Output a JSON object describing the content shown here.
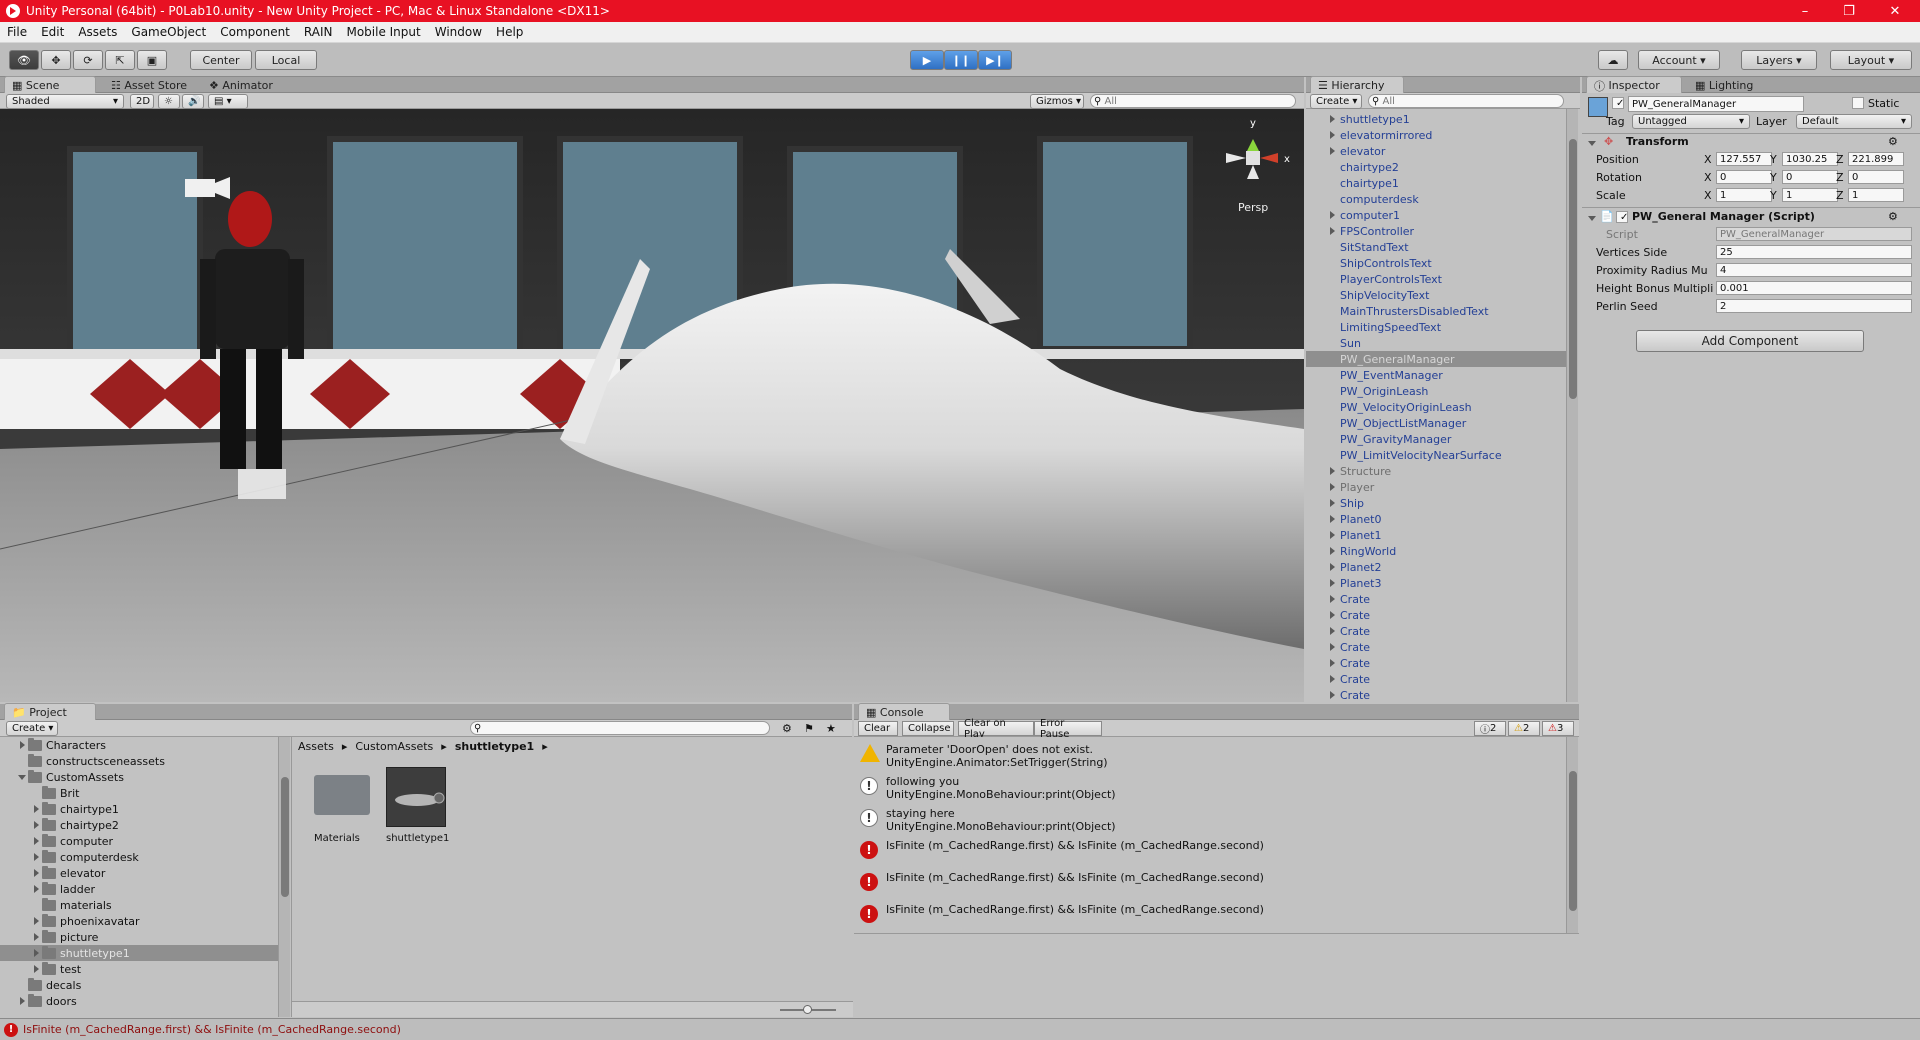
{
  "titlebar": {
    "title": "Unity Personal (64bit) - P0Lab10.unity - New Unity Project - PC, Mac & Linux Standalone <DX11>"
  },
  "menu": [
    "File",
    "Edit",
    "Assets",
    "GameObject",
    "Component",
    "RAIN",
    "Mobile Input",
    "Window",
    "Help"
  ],
  "toolbar": {
    "center": "Center",
    "local": "Local",
    "account": "Account",
    "layers": "Layers",
    "layout": "Layout"
  },
  "scene": {
    "tabs": [
      "Scene",
      "Asset Store",
      "Animator"
    ],
    "shading": "Shaded",
    "mode2d": "2D",
    "gizmos": "Gizmos",
    "search_placeholder": "All",
    "persp": "Persp",
    "axis_y": "y",
    "axis_x": "x"
  },
  "hierarchy": {
    "tab": "Hierarchy",
    "create": "Create",
    "search_placeholder": "All",
    "items": [
      {
        "name": "shuttletype1",
        "arrow": true,
        "style": "normal"
      },
      {
        "name": "elevatormirrored",
        "arrow": true,
        "style": "normal"
      },
      {
        "name": "elevator",
        "arrow": true,
        "style": "normal"
      },
      {
        "name": "chairtype2",
        "arrow": false,
        "style": "normal"
      },
      {
        "name": "chairtype1",
        "arrow": false,
        "style": "normal"
      },
      {
        "name": "computerdesk",
        "arrow": false,
        "style": "normal"
      },
      {
        "name": "computer1",
        "arrow": true,
        "style": "normal"
      },
      {
        "name": "FPSController",
        "arrow": true,
        "style": "normal"
      },
      {
        "name": "SitStandText",
        "arrow": false,
        "style": "normal"
      },
      {
        "name": "ShipControlsText",
        "arrow": false,
        "style": "normal"
      },
      {
        "name": "PlayerControlsText",
        "arrow": false,
        "style": "normal"
      },
      {
        "name": "ShipVelocityText",
        "arrow": false,
        "style": "normal"
      },
      {
        "name": "MainThrustersDisabledText",
        "arrow": false,
        "style": "normal"
      },
      {
        "name": "LimitingSpeedText",
        "arrow": false,
        "style": "normal"
      },
      {
        "name": "Sun",
        "arrow": false,
        "style": "normal"
      },
      {
        "name": "PW_GeneralManager",
        "arrow": false,
        "style": "sel"
      },
      {
        "name": "PW_EventManager",
        "arrow": false,
        "style": "normal"
      },
      {
        "name": "PW_OriginLeash",
        "arrow": false,
        "style": "normal"
      },
      {
        "name": "PW_VelocityOriginLeash",
        "arrow": false,
        "style": "normal"
      },
      {
        "name": "PW_ObjectListManager",
        "arrow": false,
        "style": "normal"
      },
      {
        "name": "PW_GravityManager",
        "arrow": false,
        "style": "normal"
      },
      {
        "name": "PW_LimitVelocityNearSurface",
        "arrow": false,
        "style": "normal"
      },
      {
        "name": "Structure",
        "arrow": true,
        "style": "grey"
      },
      {
        "name": "Player",
        "arrow": true,
        "style": "grey"
      },
      {
        "name": "Ship",
        "arrow": true,
        "style": "normal"
      },
      {
        "name": "Planet0",
        "arrow": true,
        "style": "normal"
      },
      {
        "name": "Planet1",
        "arrow": true,
        "style": "normal"
      },
      {
        "name": "RingWorld",
        "arrow": true,
        "style": "normal"
      },
      {
        "name": "Planet2",
        "arrow": true,
        "style": "normal"
      },
      {
        "name": "Planet3",
        "arrow": true,
        "style": "normal"
      },
      {
        "name": "Crate",
        "arrow": true,
        "style": "normal"
      },
      {
        "name": "Crate",
        "arrow": true,
        "style": "normal"
      },
      {
        "name": "Crate",
        "arrow": true,
        "style": "normal"
      },
      {
        "name": "Crate",
        "arrow": true,
        "style": "normal"
      },
      {
        "name": "Crate",
        "arrow": true,
        "style": "normal"
      },
      {
        "name": "Crate",
        "arrow": true,
        "style": "normal"
      },
      {
        "name": "Crate",
        "arrow": true,
        "style": "normal"
      }
    ]
  },
  "inspector": {
    "tabs": [
      "Inspector",
      "Lighting"
    ],
    "object_name": "PW_GeneralManager",
    "static_label": "Static",
    "tag_label": "Tag",
    "tag_value": "Untagged",
    "layer_label": "Layer",
    "layer_value": "Default",
    "transform": {
      "title": "Transform",
      "position_label": "Position",
      "rotation_label": "Rotation",
      "scale_label": "Scale",
      "position": {
        "x": "127.557",
        "y": "1030.25",
        "z": "221.899"
      },
      "rotation": {
        "x": "0",
        "y": "0",
        "z": "0"
      },
      "scale": {
        "x": "1",
        "y": "1",
        "z": "1"
      }
    },
    "axis_labels": {
      "x": "X",
      "y": "Y",
      "z": "Z"
    },
    "script_comp": {
      "title": "PW_General Manager (Script)",
      "script_label": "Script",
      "script_value": "PW_GeneralManager",
      "fields": [
        {
          "label": "Vertices Side",
          "value": "25"
        },
        {
          "label": "Proximity Radius Mu",
          "value": "4"
        },
        {
          "label": "Height Bonus Multipli",
          "value": "0.001"
        },
        {
          "label": "Perlin Seed",
          "value": "2"
        }
      ]
    },
    "add_component": "Add Component"
  },
  "project": {
    "tab": "Project",
    "create": "Create",
    "tree": [
      {
        "name": "Characters",
        "indent": 0,
        "arrow": "right"
      },
      {
        "name": "constructsceneassets",
        "indent": 0,
        "arrow": "none"
      },
      {
        "name": "CustomAssets",
        "indent": 0,
        "arrow": "down"
      },
      {
        "name": "Brit",
        "indent": 1,
        "arrow": "none"
      },
      {
        "name": "chairtype1",
        "indent": 1,
        "arrow": "right"
      },
      {
        "name": "chairtype2",
        "indent": 1,
        "arrow": "right"
      },
      {
        "name": "computer",
        "indent": 1,
        "arrow": "right"
      },
      {
        "name": "computerdesk",
        "indent": 1,
        "arrow": "right"
      },
      {
        "name": "elevator",
        "indent": 1,
        "arrow": "right"
      },
      {
        "name": "ladder",
        "indent": 1,
        "arrow": "right"
      },
      {
        "name": "materials",
        "indent": 1,
        "arrow": "none"
      },
      {
        "name": "phoenixavatar",
        "indent": 1,
        "arrow": "right"
      },
      {
        "name": "picture",
        "indent": 1,
        "arrow": "right"
      },
      {
        "name": "shuttletype1",
        "indent": 1,
        "arrow": "right",
        "sel": true
      },
      {
        "name": "test",
        "indent": 1,
        "arrow": "right"
      },
      {
        "name": "decals",
        "indent": 0,
        "arrow": "none"
      },
      {
        "name": "doors",
        "indent": 0,
        "arrow": "right"
      }
    ],
    "breadcrumb": [
      "Assets",
      "CustomAssets",
      "shuttletype1"
    ],
    "assets": [
      {
        "name": "Materials",
        "kind": "folder"
      },
      {
        "name": "shuttletype1",
        "kind": "model"
      }
    ]
  },
  "console": {
    "tab": "Console",
    "buttons": [
      "Clear",
      "Collapse",
      "Clear on Play",
      "Error Pause"
    ],
    "counts": {
      "info": "2",
      "warn": "2",
      "error": "3"
    },
    "entries": [
      {
        "type": "warn",
        "line1": "Parameter 'DoorOpen' does not exist.",
        "line2": "UnityEngine.Animator:SetTrigger(String)"
      },
      {
        "type": "info",
        "line1": "following you",
        "line2": "UnityEngine.MonoBehaviour:print(Object)"
      },
      {
        "type": "info",
        "line1": "staying here",
        "line2": "UnityEngine.MonoBehaviour:print(Object)"
      },
      {
        "type": "error",
        "line1": "IsFinite (m_CachedRange.first) && IsFinite (m_CachedRange.second)",
        "line2": ""
      },
      {
        "type": "error",
        "line1": "IsFinite (m_CachedRange.first) && IsFinite (m_CachedRange.second)",
        "line2": ""
      },
      {
        "type": "error",
        "line1": "IsFinite (m_CachedRange.first) && IsFinite (m_CachedRange.second)",
        "line2": ""
      }
    ]
  },
  "statusbar": {
    "message": "IsFinite (m_CachedRange.first) && IsFinite (m_CachedRange.second)"
  }
}
